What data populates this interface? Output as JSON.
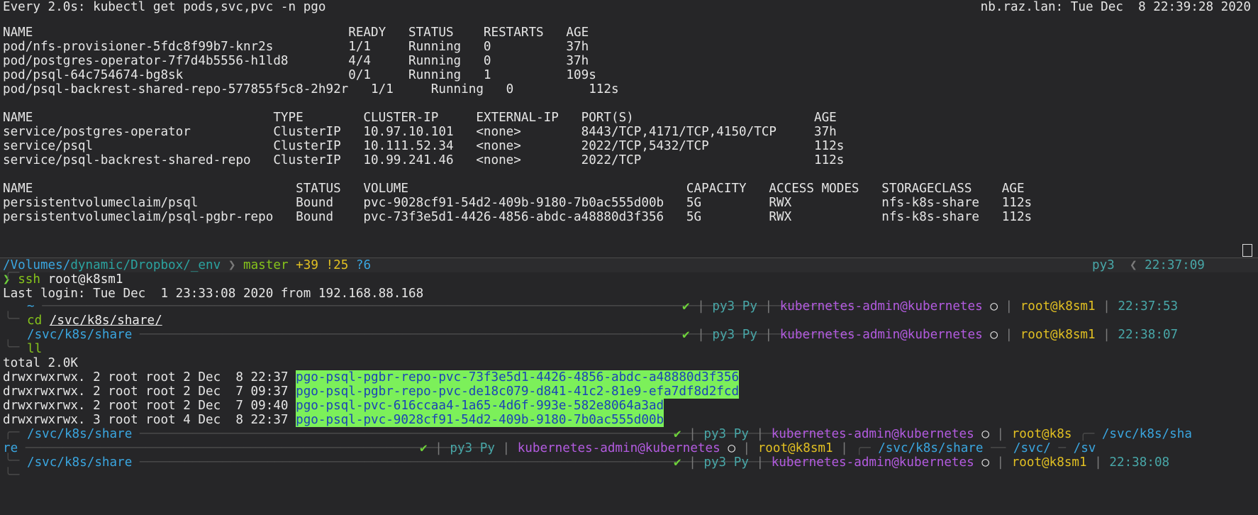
{
  "watch": {
    "header_left": "Every 2.0s: kubectl get pods,svc,pvc -n pgo",
    "header_right": "nb.raz.lan: Tue Dec  8 22:39:28 2020",
    "pods": [
      "NAME                                          READY   STATUS    RESTARTS   AGE",
      "pod/nfs-provisioner-5fdc8f99b7-knr2s          1/1     Running   0          37h",
      "pod/postgres-operator-7f7d4b5556-h1ld8        4/4     Running   0          37h",
      "pod/psql-64c754674-bg8sk                      0/1     Running   1          109s",
      "pod/psql-backrest-shared-repo-577855f5c8-2h92r   1/1     Running   0          112s"
    ],
    "services": [
      "NAME                                TYPE        CLUSTER-IP     EXTERNAL-IP   PORT(S)                        AGE",
      "service/postgres-operator           ClusterIP   10.97.10.101   <none>        8443/TCP,4171/TCP,4150/TCP     37h",
      "service/psql                        ClusterIP   10.111.52.34   <none>        2022/TCP,5432/TCP              112s",
      "service/psql-backrest-shared-repo   ClusterIP   10.99.241.46   <none>        2022/TCP                       112s"
    ],
    "pvcs": [
      "NAME                                   STATUS   VOLUME                                     CAPACITY   ACCESS MODES   STORAGECLASS    AGE",
      "persistentvolumeclaim/psql             Bound    pvc-9028cf91-54d2-409b-9180-7b0ac555d00b   5G         RWX            nfs-k8s-share   112s",
      "persistentvolumeclaim/psql-pgbr-repo   Bound    pvc-73f3e5d1-4426-4856-abdc-a48880d3f356   5G         RWX            nfs-k8s-share   112s"
    ]
  },
  "shell": {
    "path_parts": [
      "/Volumes/",
      "dynamic/",
      "Dropbox/",
      "_env"
    ],
    "git_branch": "master",
    "git_ahead": "+39",
    "git_modified": "!25",
    "git_untracked": "?6",
    "env": "py3",
    "time1": "22:37:09",
    "command_ssh": "ssh root@k8sm1",
    "last_login": "Last login: Tue Dec  1 23:33:08 2020 from 192.168.88.168",
    "home": "~",
    "status_check": "✔",
    "status_env": "py3 Py",
    "status_ctx": "kubernetes-admin@kubernetes",
    "status_circle": "○",
    "status_user": "root@k8sm1",
    "status_user_trunc": "root@k8s",
    "time2": "22:37:53",
    "command_cd": "cd /svc/k8s/share/",
    "cwd": "/svc/k8s/share",
    "time3": "22:38:07",
    "command_ll": "ll",
    "total": "total 2.0K",
    "ls": [
      {
        "meta": "drwxrwxrwx. 2 root root 2 Dec  8 22:37 ",
        "name": "pgo-psql-pgbr-repo-pvc-73f3e5d1-4426-4856-abdc-a48880d3f356"
      },
      {
        "meta": "drwxrwxrwx. 2 root root 2 Dec  7 09:37 ",
        "name": "pgo-psql-pgbr-repo-pvc-de18c079-d841-41c2-81e9-efa7df8d2fcd"
      },
      {
        "meta": "drwxrwxrwx. 2 root root 2 Dec  7 09:40 ",
        "name": "pgo-psql-pvc-616ccaa4-1a65-4d6f-993e-582e8064a3ad"
      },
      {
        "meta": "drwxrwxrwx. 3 root root 4 Dec  8 22:37 ",
        "name": "pgo-psql-pvc-9028cf91-54d2-409b-9180-7b0ac555d00b"
      }
    ],
    "wrap_cwd_tail": "/svc/k8s/sha",
    "wrap_re": "re",
    "wrap_svc": "/svc/",
    "wrap_sv": "/sv",
    "time4": "22:38:08"
  }
}
